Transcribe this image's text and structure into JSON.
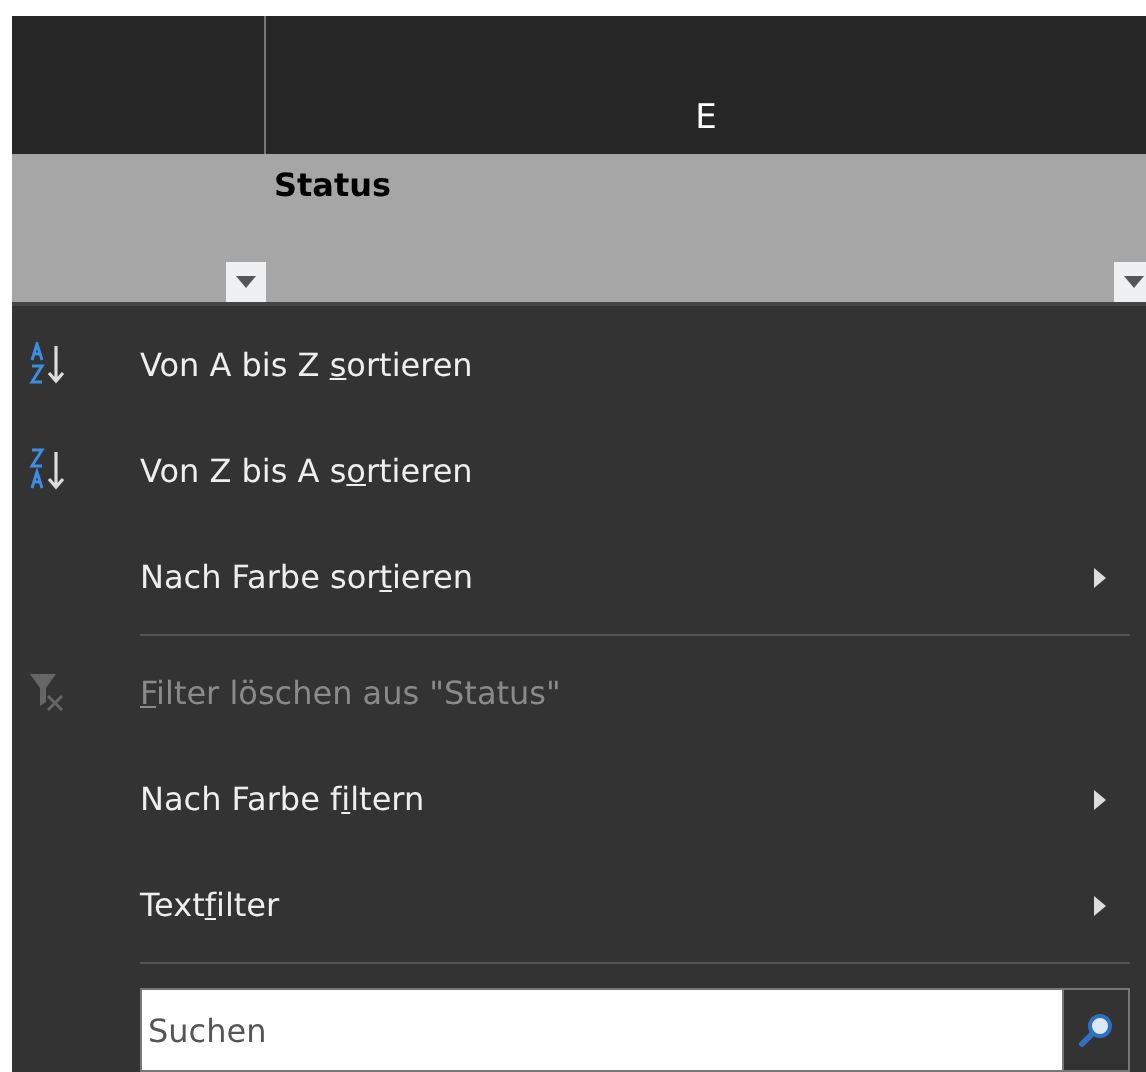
{
  "sheet": {
    "column_letter": "E",
    "header_cell": "Status"
  },
  "menu": {
    "items": [
      {
        "kind": "sort-ascending",
        "before": "Von A bis Z ",
        "key": "s",
        "after": "ortieren",
        "disabled": false,
        "submenu": false
      },
      {
        "kind": "sort-descending",
        "before": "Von Z bis A s",
        "key": "o",
        "after": "rtieren",
        "disabled": false,
        "submenu": false
      },
      {
        "kind": "plain",
        "before": "Nach Farbe sor",
        "key": "t",
        "after": "ieren",
        "disabled": false,
        "submenu": true
      },
      {
        "kind": "separator"
      },
      {
        "kind": "clear-filter",
        "key": "F",
        "after": "ilter löschen aus \"Status\"",
        "disabled": true,
        "submenu": false
      },
      {
        "kind": "plain",
        "before": "Nach Farbe f",
        "key": "i",
        "after": "ltern",
        "disabled": false,
        "submenu": true
      },
      {
        "kind": "plain",
        "before": "Text",
        "key": "f",
        "after": "ilter",
        "disabled": false,
        "submenu": true
      },
      {
        "kind": "separator"
      }
    ],
    "search": {
      "placeholder": "Suchen"
    }
  }
}
